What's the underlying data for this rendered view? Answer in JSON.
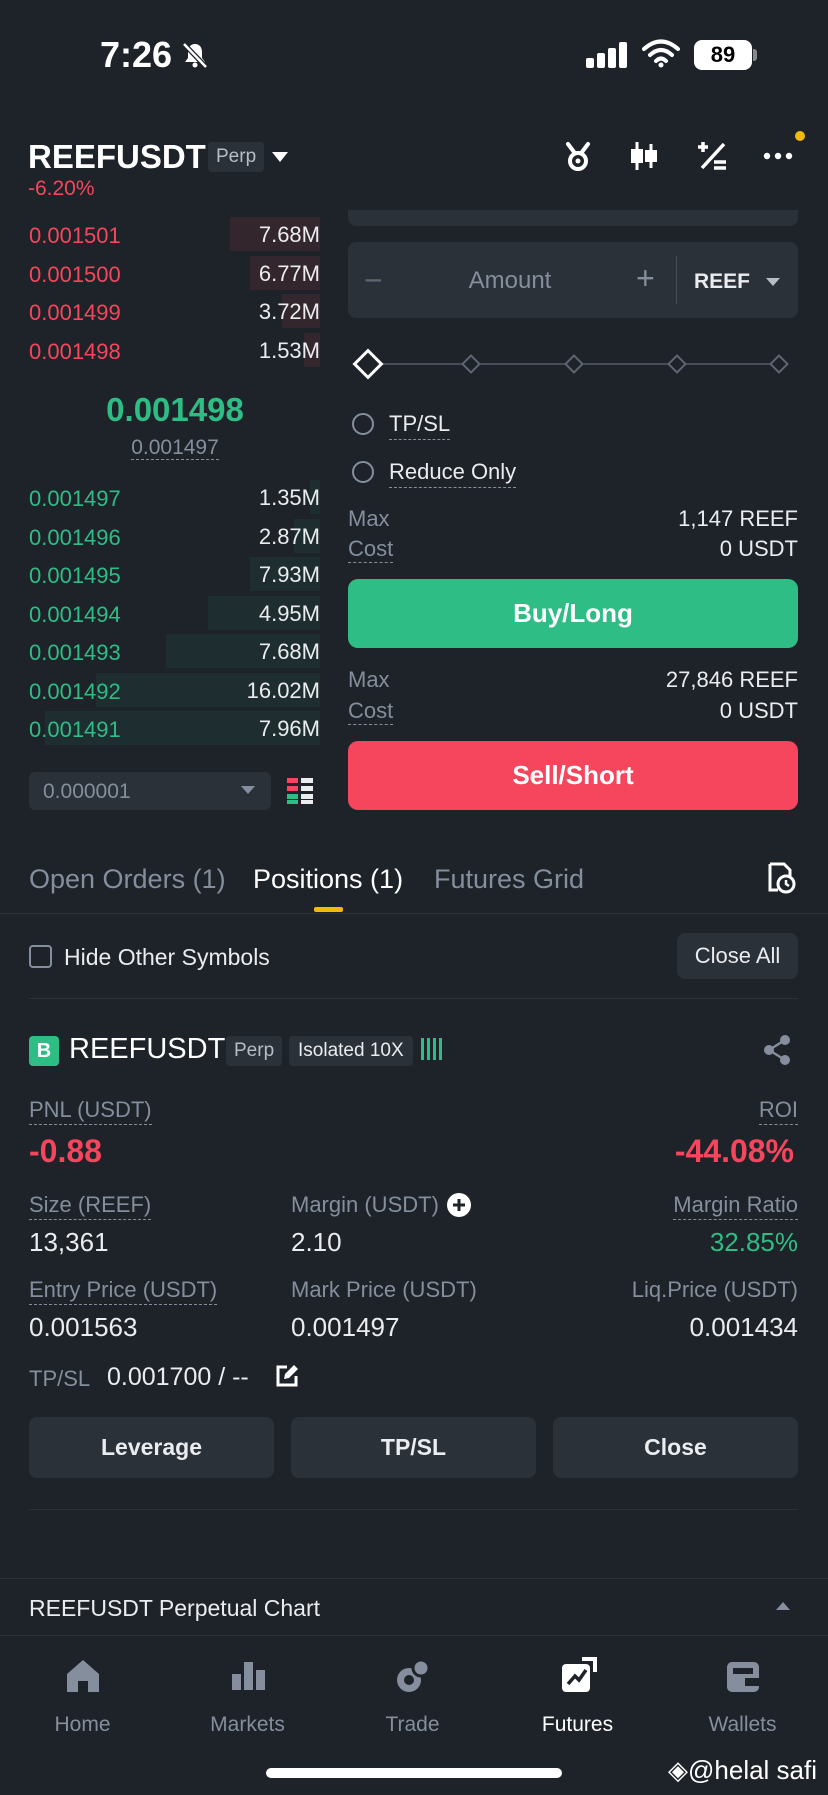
{
  "status": {
    "time": "7:26",
    "battery": "89"
  },
  "header": {
    "symbol": "REEFUSDT",
    "contract": "Perp",
    "change": "-6.20%"
  },
  "orderbook": {
    "asks": [
      {
        "price": "0.001501",
        "qty": "7.68M",
        "depth": 0.28
      },
      {
        "price": "0.001500",
        "qty": "6.77M",
        "depth": 0.22
      },
      {
        "price": "0.001499",
        "qty": "3.72M",
        "depth": 0.12
      },
      {
        "price": "0.001498",
        "qty": "1.53M",
        "depth": 0.05
      }
    ],
    "last_price": "0.001498",
    "mark_price": "0.001497",
    "bids": [
      {
        "price": "0.001497",
        "qty": "1.35M",
        "depth": 0.03
      },
      {
        "price": "0.001496",
        "qty": "2.87M",
        "depth": 0.08
      },
      {
        "price": "0.001495",
        "qty": "7.93M",
        "depth": 0.22
      },
      {
        "price": "0.001494",
        "qty": "4.95M",
        "depth": 0.35
      },
      {
        "price": "0.001493",
        "qty": "7.68M",
        "depth": 0.48
      },
      {
        "price": "0.001492",
        "qty": "16.02M",
        "depth": 0.7
      },
      {
        "price": "0.001491",
        "qty": "7.96M",
        "depth": 0.86
      }
    ],
    "tick_size": "0.000001"
  },
  "order_form": {
    "amount_placeholder": "Amount",
    "unit": "REEF",
    "tpsl_label": "TP/SL",
    "reduce_only_label": "Reduce Only",
    "buy": {
      "max_label": "Max",
      "max_value": "1,147 REEF",
      "cost_label": "Cost",
      "cost_value": "0 USDT",
      "button": "Buy/Long"
    },
    "sell": {
      "max_label": "Max",
      "max_value": "27,846 REEF",
      "cost_label": "Cost",
      "cost_value": "0 USDT",
      "button": "Sell/Short"
    }
  },
  "tabs": {
    "open_orders": "Open Orders (1)",
    "positions": "Positions (1)",
    "grid": "Futures Grid"
  },
  "filters": {
    "hide_other": "Hide Other Symbols",
    "close_all": "Close All"
  },
  "position": {
    "side_badge": "B",
    "symbol": "REEFUSDT",
    "contract": "Perp",
    "margin_mode": "Isolated 10X",
    "pnl_label": "PNL (USDT)",
    "pnl": "-0.88",
    "roi_label": "ROI",
    "roi": "-44.08%",
    "size_label": "Size (REEF)",
    "size": "13,361",
    "margin_label": "Margin (USDT)",
    "margin": "2.10",
    "margin_ratio_label": "Margin Ratio",
    "margin_ratio": "32.85%",
    "entry_label": "Entry Price (USDT)",
    "entry": "0.001563",
    "mark_label": "Mark Price (USDT)",
    "mark": "0.001497",
    "liq_label": "Liq.Price (USDT)",
    "liq": "0.001434",
    "tpsl_label": "TP/SL",
    "tpsl": "0.001700 / --",
    "buttons": {
      "leverage": "Leverage",
      "tpsl": "TP/SL",
      "close": "Close"
    }
  },
  "chart_bar": {
    "label": "REEFUSDT Perpetual  Chart"
  },
  "nav": [
    {
      "label": "Home",
      "icon": "home-icon"
    },
    {
      "label": "Markets",
      "icon": "markets-icon"
    },
    {
      "label": "Trade",
      "icon": "trade-icon"
    },
    {
      "label": "Futures",
      "icon": "futures-icon"
    },
    {
      "label": "Wallets",
      "icon": "wallets-icon"
    }
  ],
  "watermark": "@helal safi",
  "colors": {
    "buy": "#2ebd85",
    "sell": "#f6465d",
    "accent": "#f0b90b",
    "bg": "#1e2329"
  }
}
